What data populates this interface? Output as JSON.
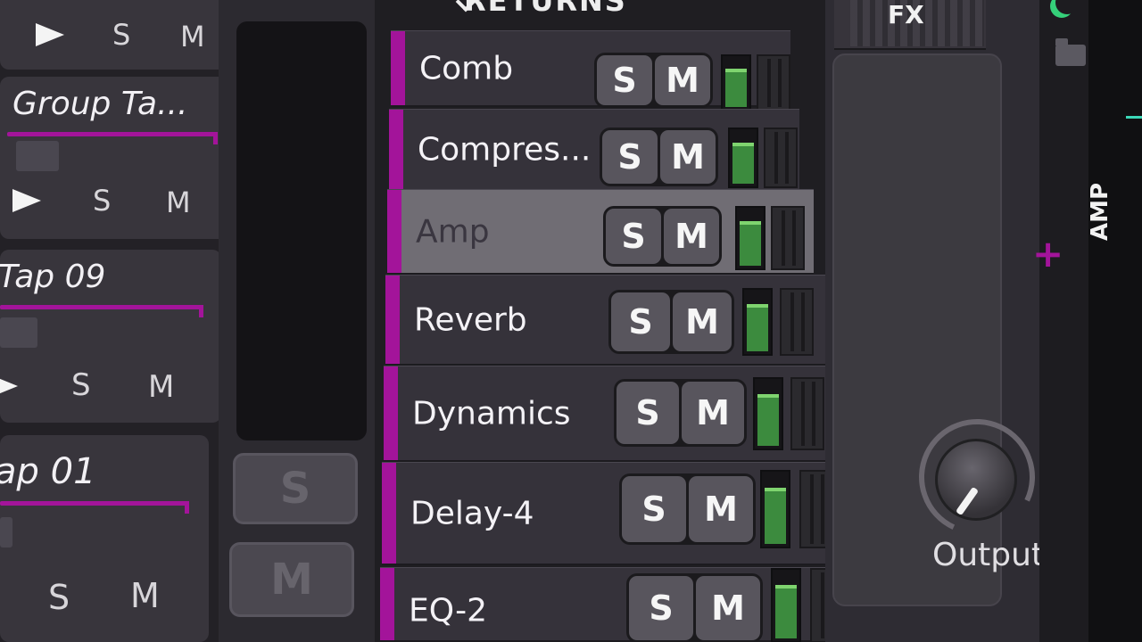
{
  "returns_header": "RETURNS",
  "group_tracks": [
    {
      "name": "",
      "play": "play",
      "solo": "S",
      "mute": "M"
    },
    {
      "name": "Group Ta...",
      "play": "play",
      "solo": "S",
      "mute": "M"
    },
    {
      "name": "Tap 09",
      "play": "play",
      "solo": "S",
      "mute": "M"
    },
    {
      "name": "ap 01",
      "solo": "S",
      "mute": "M"
    }
  ],
  "strip_buttons": {
    "solo": "S",
    "mute": "M"
  },
  "returns": [
    {
      "name": "Comb",
      "solo": "S",
      "mute": "M",
      "level": 0.82
    },
    {
      "name": "Compres...",
      "solo": "S",
      "mute": "M",
      "level": 0.82
    },
    {
      "name": "Amp",
      "solo": "S",
      "mute": "M",
      "level": 0.82,
      "selected": true
    },
    {
      "name": "Reverb",
      "solo": "S",
      "mute": "M",
      "level": 0.82
    },
    {
      "name": "Dynamics",
      "solo": "S",
      "mute": "M",
      "level": 0.82
    },
    {
      "name": "Delay-4",
      "solo": "S",
      "mute": "M",
      "level": 0.82
    },
    {
      "name": "EQ-2",
      "solo": "S",
      "mute": "M",
      "level": 0.82
    }
  ],
  "fx": {
    "label": "FX"
  },
  "output": {
    "label": "Output"
  },
  "right_panel": {
    "device_label": "AMP"
  },
  "colors": {
    "accent": "#a3149a",
    "meter": "#3c8b3e",
    "meter_peak": "#7fd46f",
    "teal": "#3bd8b8"
  }
}
